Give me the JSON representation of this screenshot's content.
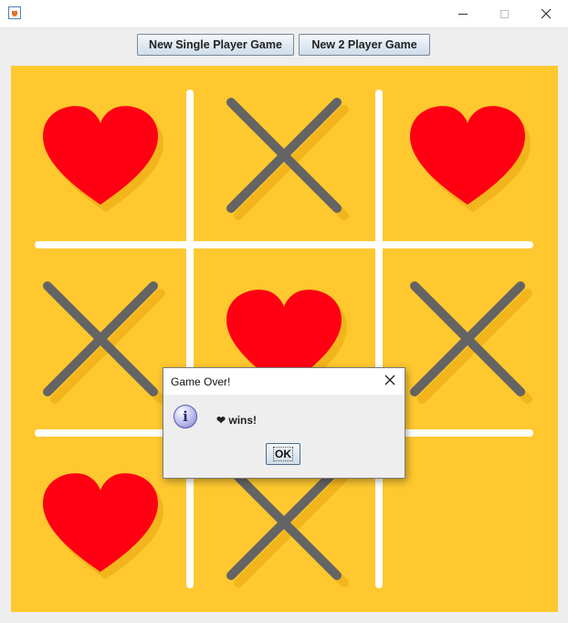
{
  "window": {
    "title": "",
    "controls": [
      "minimize",
      "maximize",
      "close"
    ]
  },
  "toolbar": {
    "single_player_label": "New Single Player Game",
    "two_player_label": "New 2 Player Game"
  },
  "board": {
    "cells": [
      [
        "heart",
        "x",
        "heart"
      ],
      [
        "x",
        "heart",
        "x"
      ],
      [
        "heart",
        "x",
        ""
      ]
    ],
    "colors": {
      "background": "#ffc82f",
      "grid_lines": "#ffffff",
      "heart": "#ff0012",
      "x_mark": "#646464",
      "shadow": "#f2b51b"
    }
  },
  "dialog": {
    "title": "Game Over!",
    "icon": "info-icon",
    "message": "❤ wins!",
    "ok_label": "OK"
  }
}
